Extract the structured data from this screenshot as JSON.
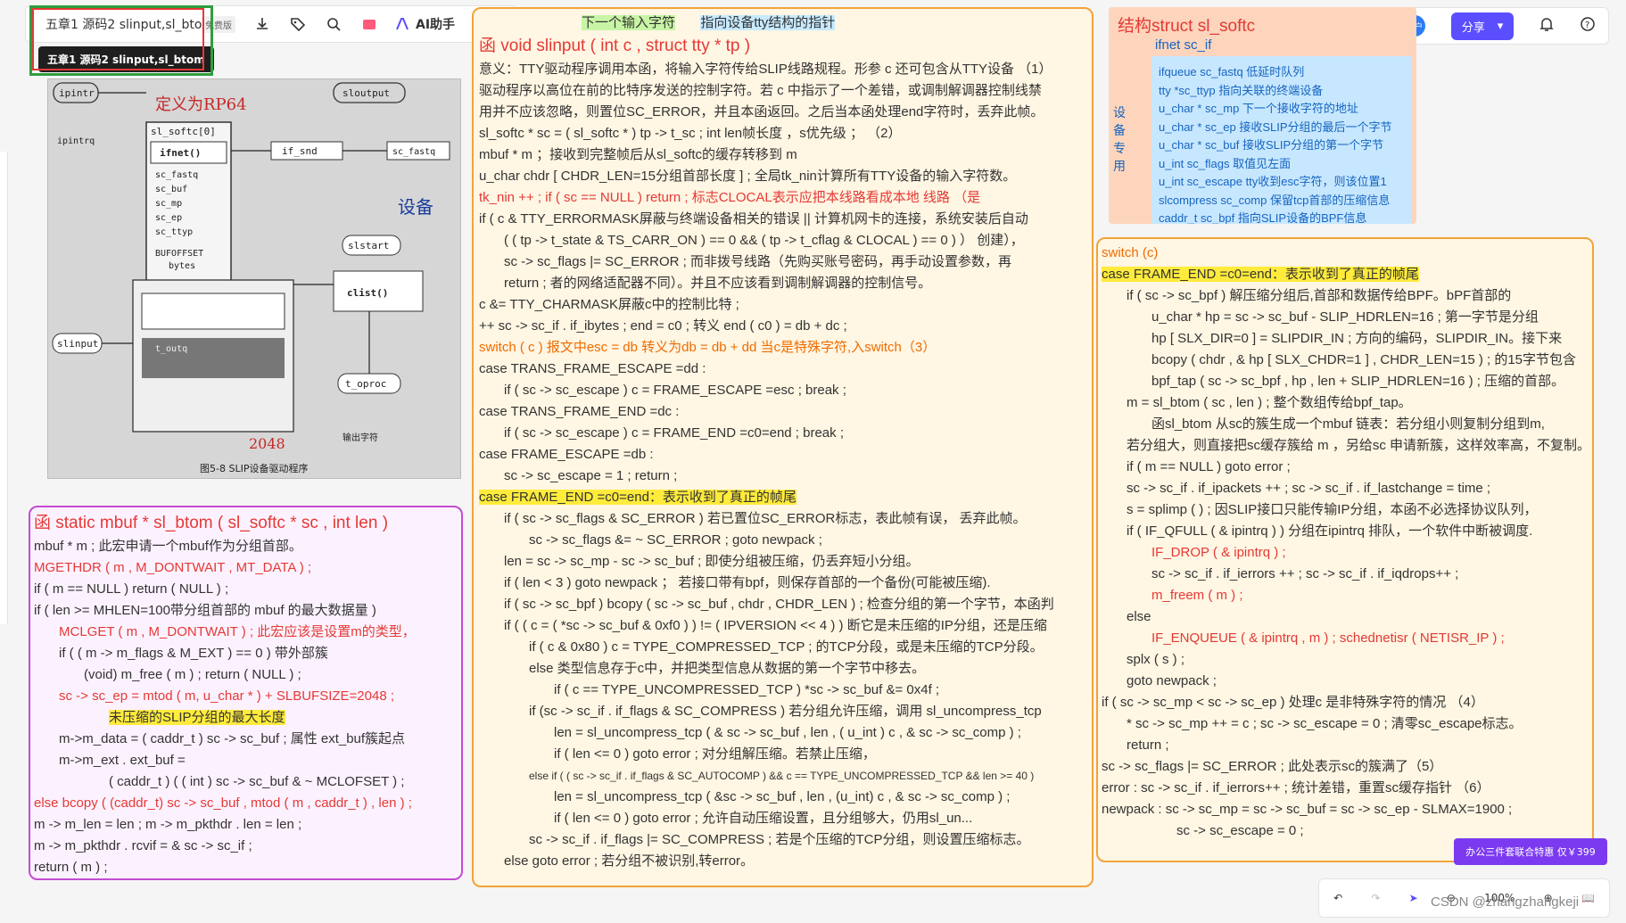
{
  "toolbar": {
    "doc_title": "五章1 源码2 slinput,sl_bto...",
    "badge": "免费版",
    "ai_label": "AI助手",
    "tooltip": "五章1 源码2 slinput,sl_btom"
  },
  "topright": {
    "share_label": "分享",
    "avatar_label": "用户"
  },
  "figure": {
    "caption": "图5-8 SLIP设备驱动程序",
    "labels": [
      "ipintr",
      "定义为RP64",
      "sloutput",
      "sl_softc[0]",
      "ifnet()",
      "if_snd",
      "sc_fastq",
      "sc_fastq",
      "sc_buf",
      "sc_mp",
      "sc_ep",
      "sc_ttyp",
      "BUFOFFSET",
      "bytes",
      "slstart",
      "clist()",
      "slinput",
      "t_outq",
      "t_oproc",
      "2048",
      "输出字符",
      "ipintrq",
      "设备"
    ]
  },
  "pink": {
    "title": "函    static  mbuf *  sl_btom ( sl_softc * sc , int   len  )",
    "lines": [
      "mbuf  * m ;           此宏申请一个mbuf作为分组首部。",
      "MGETHDR ( m , M_DONTWAIT ,  MT_DATA ) ;",
      "if ( m  ==  NULL )      return   ( NULL ) ;",
      "if ( len >=  MHLEN=100带分组首部的 mbuf 的最大数据量 )",
      "MCLGET ( m ,  M_DONTWAIT ) ; 此宏应该是设置m的类型，",
      "if (  ( m -> m_flags  &  M_EXT )  ==  0  )          带外部簇",
      "(void) m_free ( m ) ;     return   ( NULL ) ;",
      "sc -> sc_ep  =  mtod ( m,  u_char * )  + SLBUFSIZE=2048 ;",
      "未压缩的SLIP分组的最大长度",
      "m->m_data  = ( caddr_t ) sc -> sc_buf ;      属性 ext_buf簇起点",
      "m->m_ext . ext_buf =",
      "( caddr_t ) ( ( int ) sc -> sc_buf   & ~ MCLOFSET    ) ;",
      "else     bcopy ( (caddr_t) sc -> sc_buf ,  mtod ( m , caddr_t ) , len ) ;",
      "m -> m_len  =  len ;  m -> m_pkthdr . len  =  len ;",
      "m -> m_pkthdr . rcvif  =  & sc -> sc_if ;",
      "return    ( m ) ;"
    ]
  },
  "mid": {
    "heading1": "下一个输入字符",
    "heading2": "指向设备tty结构的指针",
    "title": "函    void   slinput ( int  c  ,  struct   tty   *  tp  )",
    "lines": [
      "意义：TTY驱动程序调用本函，将输入字符传给SLIP线路规程。形参 c 还可包含从TTY设备 （1）",
      "驱动程序以高位在前的比特序发送的控制字符。若 c 中指示了一个差错，或调制解调器控制线禁",
      "用并不应该忽略，则置位SC_ERROR，并且本函返回。之后当本函处理end字符时，丢弃此帧。",
      "sl_softc  * sc = ( sl_softc * ) tp -> t_sc ;        int   len帧长度 ，s优先级 ；                          （2）",
      "mbuf  * m ；接收到完整帧后从sl_softc的缓存转移到 m",
      "u_char   chdr [ CHDR_LEN=15分组首部长度 ] ;        全局tk_nin计算所有TTY设备的输入字符数。",
      "tk_nin ++ ;    if ( sc  ==  NULL )     return ;       标志CLOCAL表示应把本线路看成本地 线路 （是",
      "if ( c  &  TTY_ERRORMASK屏蔽与终端设备相关的错误   ||     计算机网卡的连接，系统安装后自动",
      "( ( tp -> t_state  &  TS_CARR_ON ) == 0  &&  ( tp -> t_cflag  &  CLOCAL )  ==  0 ) ）  创建），",
      "sc -> sc_flags   |=   SC_ERROR ;      而非拨号线路（先购买账号密码，再手动设置参数，再",
      "return ;                    者的网络适配器不同）。并且不应该看到调制解调器的控制信号。",
      "c  &=   TTY_CHARMASK屏蔽c中的控制比特 ;",
      "++ sc -> sc_if . if_ibytes ;    end = c0 ;    转义 end ( c0 )  = db + dc ;",
      "switch ( c )                  报文中esc = db  转义为db = db + dd      当c是特殊字符,入switch（3）",
      "case   TRANS_FRAME_ESCAPE =dd   :",
      "if ( sc -> sc_escape )      c  =  FRAME_ESCAPE =esc ;          break ;",
      "case   TRANS_FRAME_END =dc   :",
      "if ( sc -> sc_escape )      c  =  FRAME_END =c0=end ;          break ;",
      "case   FRAME_ESCAPE =db   :",
      "sc -> sc_escape  =  1 ;     return ;",
      "case  FRAME_END =c0=end：表示收到了真正的帧尾",
      "if ( sc -> sc_flags  &  SC_ERROR )        若已置位SC_ERROR标志，表此帧有误，  丢弃此帧。",
      "sc -> sc_flags  &= ~ SC_ERROR ;       goto   newpack ;",
      "len  =  sc -> sc_mp  -  sc -> sc_buf ;            即使分组被压缩，仍丢弃短小分组。",
      "if ( len  <  3 )       goto   newpack ；   若接口带有bpf，则保存首部的一个备份(可能被压缩).",
      "if ( sc -> sc_bpf )       bcopy ( sc -> sc_buf , chdr , CHDR_LEN ) ; 检查分组的第一个字节，本函判",
      "if ( ( c  = ( *sc -> sc_buf  &  0xf0 ) )  !=  ( IPVERSION << 4 ) )    断它是未压缩的IP分组，还是压缩",
      "if ( c  &  0x80 )      c  =  TYPE_COMPRESSED_TCP ;       的TCP分段，或是未压缩的TCP分段。",
      "else                                  类型信息存于c中，并把类型信息从数据的第一个字节中移去。",
      "if ( c  ==  TYPE_UNCOMPRESSED_TCP )     *sc -> sc_buf  &=  0x4f ;",
      "if (sc -> sc_if . if_flags & SC_COMPRESS )       若分组允许压缩，调用 sl_uncompress_tcp",
      "len  =  sl_uncompress_tcp ( & sc -> sc_buf , len , ( u_int ) c , & sc -> sc_comp ) ;",
      "if ( len  <=  0 )       goto    error ;                  对分组解压缩。若禁止压缩，",
      "else if ( ( sc -> sc_if . if_flags & SC_AUTOCOMP ) && c == TYPE_UNCOMPRESSED_TCP && len >= 40 )",
      "len  =  sl_uncompress_tcp ( &sc -> sc_buf , len ,  (u_int) c , & sc -> sc_comp ) ;",
      "if ( len  <=  0 )      goto   error ;         允许自动压缩设置，且分组够大，仍用sl_un...",
      "sc -> sc_if . if_flags  |=   SC_COMPRESS  ;      若是个压缩的TCP分组，则设置压缩标志。",
      "else        goto   error ;                         若分组不被识别,转error。"
    ]
  },
  "struct": {
    "title": "结构struct    sl_softc",
    "side_label": "设备专用",
    "lines": [
      "ifnet   sc_if",
      "ifqueue    sc_fastq   低延时队列",
      "tty    *sc_ttyp 指向关联的终端设备",
      "u_char *   sc_mp   下一个接收字符的地址",
      "u_char *   sc_ep   接收SLIP分组的最后一个字节",
      "u_char *   sc_buf  接收SLIP分组的第一个字节",
      "u_int    sc_flags 取值见左面",
      "u_int   sc_escape tty收到esc字符，则该位置1",
      "slcompress    sc_comp  保留tcp首部的压缩信息",
      "caddr_t     sc_bpf 指向SLIP设备的BPF信息"
    ]
  },
  "right": {
    "lines": [
      "switch (c)",
      "case  FRAME_END =c0=end：表示收到了真正的帧尾",
      "if ( sc -> sc_bpf )           解压缩分组后,首部和数据传给BPF。bPF首部的",
      "u_char  * hp  =  sc -> sc_buf  -  SLIP_HDRLEN=16 ;  第一字节是分组",
      "hp [ SLX_DIR=0 ]  =  SLIPDIR_IN ;   方向的编码，SLIPDIR_IN。接下来",
      "bcopy ( chdr ,  & hp [ SLX_CHDR=1 ] , CHDR_LEN=15 ) ; 的15字节包含",
      "bpf_tap ( sc -> sc_bpf , hp , len  +  SLIP_HDRLEN=16 ) ; 压缩的首部。",
      "m  =  sl_btom ( sc , len ) ;                       整个数组传给bpf_tap。",
      "函sl_btom 从sc的簇生成一个mbuf 链表：若分组小则复制分组到m,",
      "若分组大，则直接把sc缓存簇给 m ，另给sc 申请新簇，这样效率高，不复制。",
      "if ( m ==  NULL )      goto    error  ;",
      "sc -> sc_if . if_ipackets ++ ;      sc -> sc_if . if_lastchange  =  time ;",
      "s  =  splimp ( ) ;       因SLIP接口只能传输IP分组，本函不必选择协议队列，",
      "if   ( IF_QFULL ( & ipintrq ) )    分组在ipintrq 排队，一个软件中断被调度.",
      "IF_DROP ( & ipintrq ) ;",
      "sc -> sc_if . if_ierrors ++ ;       sc -> sc_if . if_iqdrops++ ;",
      "m_freem ( m ) ;",
      "else",
      "IF_ENQUEUE ( & ipintrq , m ) ;        schednetisr ( NETISR_IP ) ;",
      "splx ( s ) ;",
      "goto   newpack ;",
      "if ( sc -> sc_mp   <  sc -> sc_ep )          处理c 是非特殊字符的情况  （4）",
      "* sc -> sc_mp ++  = c ;       sc -> sc_escape  =  0 ; 清零sc_escape标志。",
      "return  ;",
      "sc -> sc_flags   |=  SC_ERROR ;                    此处表示sc的簇满了（5）",
      "error    :  sc -> sc_if . if_ierrors++ ;          统计差错，重置sc缓存指针   （6）",
      "newpack  :       sc -> sc_mp  =  sc -> sc_buf  =  sc -> sc_ep  -  SLMAX=1900 ;",
      "sc -> sc_escape  =  0 ;"
    ]
  },
  "promo": "办公三件套联合特惠 仅￥399",
  "zoom": "100%",
  "watermark": "CSDN @zhangzhangkeji"
}
